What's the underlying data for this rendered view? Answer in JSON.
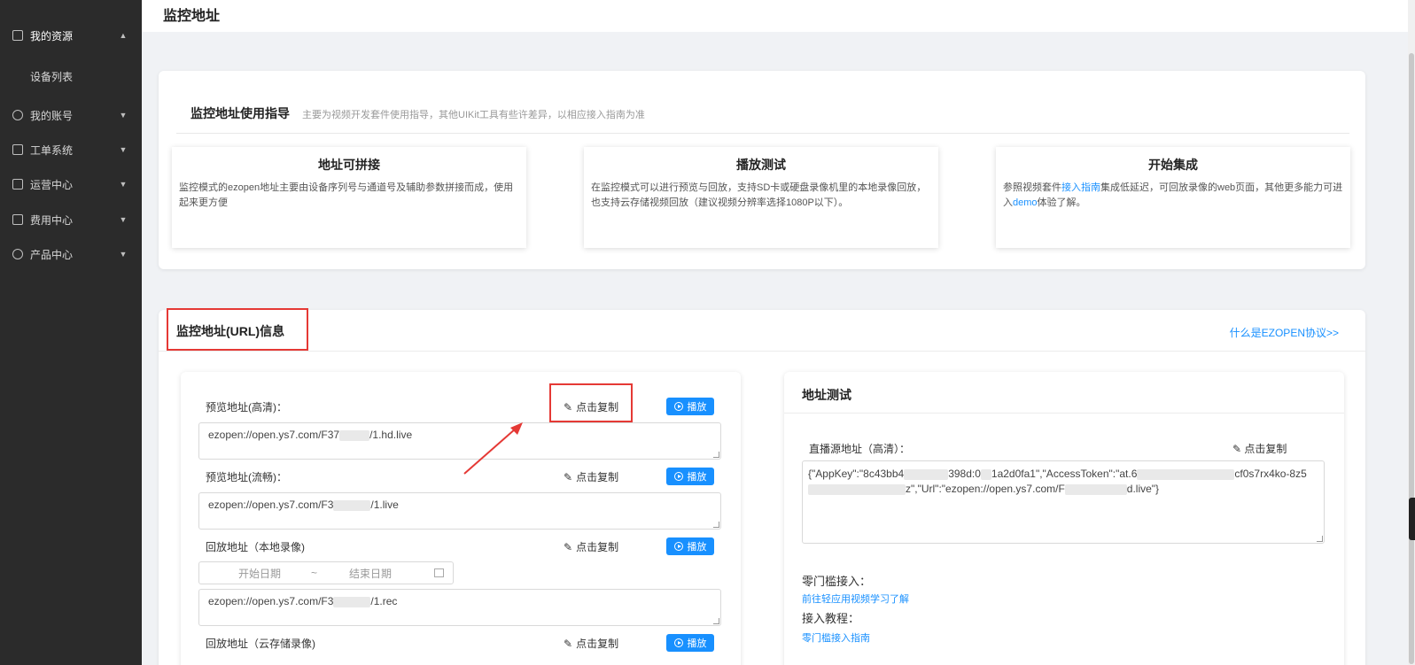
{
  "colors": {
    "sidebar_bg": "#2b2b2b",
    "accent": "#1890ff",
    "highlight": "#e53935"
  },
  "sidebar": {
    "items": [
      {
        "label": "我的资源",
        "icon": "document-icon",
        "expanded": true
      },
      {
        "label": "我的账号",
        "icon": "account-icon",
        "expanded": false
      },
      {
        "label": "工单系统",
        "icon": "ticket-icon",
        "expanded": false
      },
      {
        "label": "运营中心",
        "icon": "operation-icon",
        "expanded": false
      },
      {
        "label": "费用中心",
        "icon": "billing-icon",
        "expanded": false
      },
      {
        "label": "产品中心",
        "icon": "product-icon",
        "expanded": false
      }
    ],
    "sub_item": "设备列表"
  },
  "header": {
    "title": "监控地址"
  },
  "guide": {
    "title": "监控地址使用指导",
    "subtitle": "主要为视频开发套件使用指导，其他UIKit工具有些许差异，以相应接入指南为准",
    "tiles": [
      {
        "title": "地址可拼接",
        "desc": "监控模式的ezopen地址主要由设备序列号与通道号及辅助参数拼接而成，使用起来更方便"
      },
      {
        "title": "播放测试",
        "desc": "在监控模式可以进行预览与回放，支持SD卡或硬盘录像机里的本地录像回放，也支持云存储视频回放（建议视频分辨率选择1080P以下）。"
      },
      {
        "title": "开始集成",
        "desc_before": "参照视频套件",
        "desc_link": "接入指南",
        "desc_mid": "集成低延迟，可回放录像的web页面，其他更多能力可进入",
        "desc_link2": "demo",
        "desc_after": "体验了解。"
      }
    ]
  },
  "url_info": {
    "title": "监控地址(URL)信息",
    "what_link": "什么是EZOPEN协议>>",
    "copy_label": "点击复制",
    "play_label": "播放",
    "rows": [
      {
        "label": "预览地址(高清)：",
        "url_prefix": "ezopen://open.ys7.com/F37",
        "url_suffix": "/1.hd.live"
      },
      {
        "label": "预览地址(流畅)：",
        "url_prefix": "ezopen://open.ys7.com/F3",
        "url_suffix": "/1.live"
      },
      {
        "label": "回放地址（本地录像)",
        "url_prefix": "ezopen://open.ys7.com/F3",
        "url_suffix": "/1.rec"
      },
      {
        "label": "回放地址（云存储录像)"
      }
    ],
    "date_start": "开始日期",
    "date_sep": "~",
    "date_end": "结束日期"
  },
  "test_panel": {
    "title": "地址测试",
    "live_label": "直播源地址（高清）：",
    "copy_label": "点击复制",
    "json_line1_a": "{\"AppKey\":\"8c43bb4",
    "json_line1_b": "398d:0",
    "json_line1_c": "1a2d0fa1\",\"AccessToken\":\"at.6",
    "json_line1_d": "cf0s7rx",
    "json_line2_a": "4ko-8z5",
    "json_line2_b": "z\",\"Url\":\"ezopen://open.ys7.com/F",
    "json_line2_c": "d.live\"}",
    "zero_label": "零门槛接入：",
    "zero_link": "前往轻应用视频学习了解",
    "tutorial_label": "接入教程：",
    "tutorial_link": "零门槛接入指南"
  }
}
